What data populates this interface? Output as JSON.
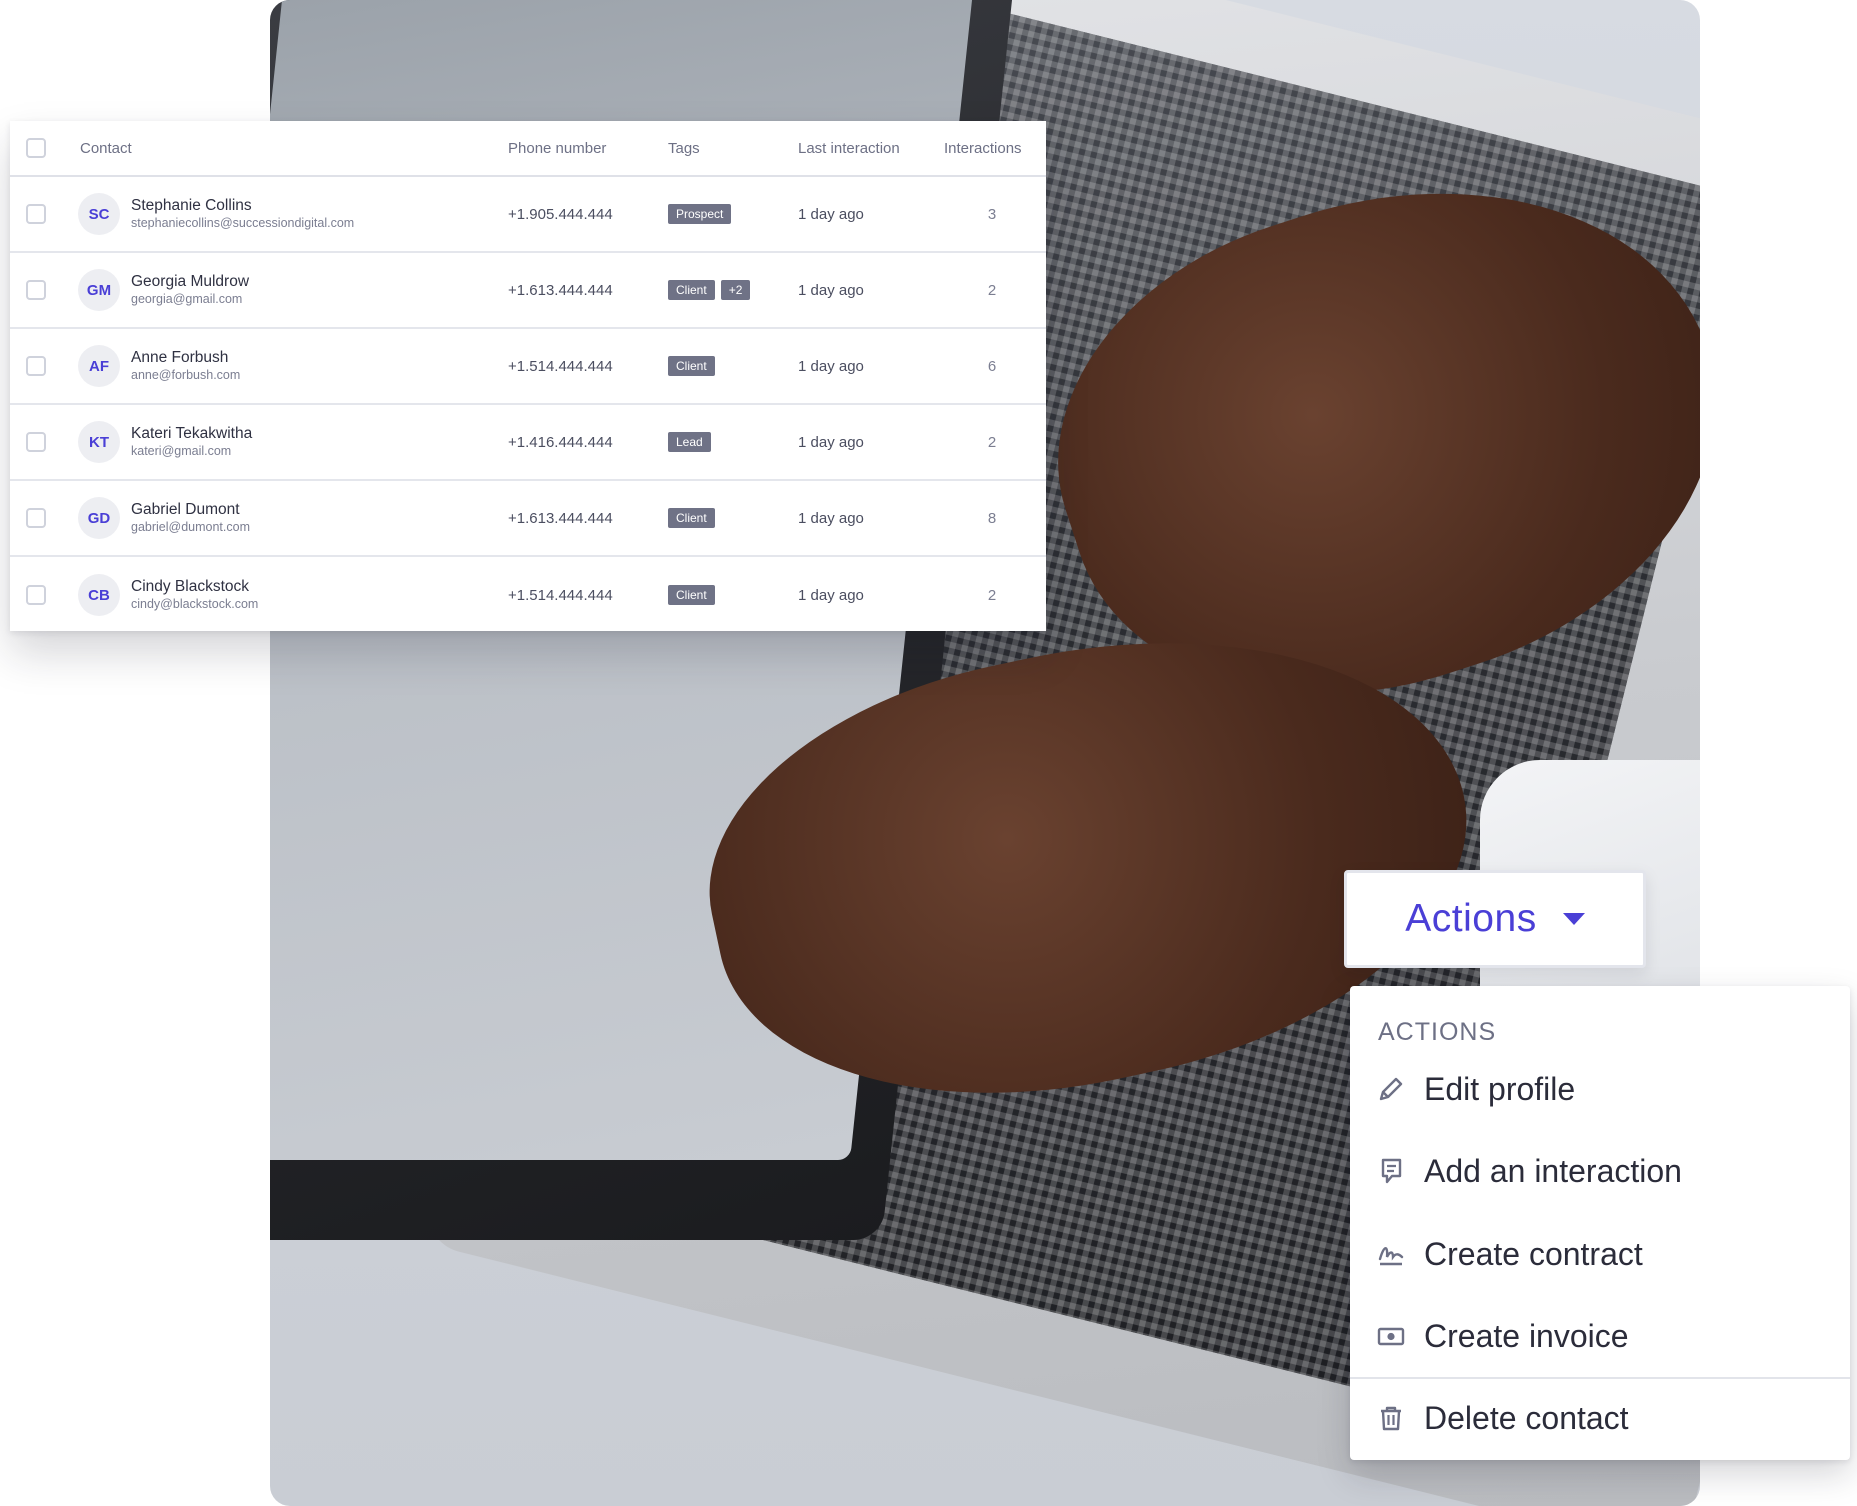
{
  "table": {
    "headers": {
      "contact": "Contact",
      "phone": "Phone number",
      "tags": "Tags",
      "last_interaction": "Last interaction",
      "interactions": "Interactions"
    },
    "rows": [
      {
        "initials": "SC",
        "name": "Stephanie Collins",
        "email": "stephaniecollins@successiondigital.com",
        "phone": "+1.905.444.444",
        "tags": [
          "Prospect"
        ],
        "last": "1 day ago",
        "count": "3"
      },
      {
        "initials": "GM",
        "name": "Georgia Muldrow",
        "email": "georgia@gmail.com",
        "phone": "+1.613.444.444",
        "tags": [
          "Client",
          "+2"
        ],
        "last": "1 day ago",
        "count": "2"
      },
      {
        "initials": "AF",
        "name": "Anne Forbush",
        "email": "anne@forbush.com",
        "phone": "+1.514.444.444",
        "tags": [
          "Client"
        ],
        "last": "1 day ago",
        "count": "6"
      },
      {
        "initials": "KT",
        "name": "Kateri Tekakwitha",
        "email": "kateri@gmail.com",
        "phone": "+1.416.444.444",
        "tags": [
          "Lead"
        ],
        "last": "1 day ago",
        "count": "2"
      },
      {
        "initials": "GD",
        "name": "Gabriel Dumont",
        "email": "gabriel@dumont.com",
        "phone": "+1.613.444.444",
        "tags": [
          "Client"
        ],
        "last": "1 day ago",
        "count": "8"
      },
      {
        "initials": "CB",
        "name": "Cindy Blackstock",
        "email": "cindy@blackstock.com",
        "phone": "+1.514.444.444",
        "tags": [
          "Client"
        ],
        "last": "1 day ago",
        "count": "2"
      }
    ]
  },
  "actions_button": {
    "label": "Actions",
    "icon": "chevron-down-icon"
  },
  "menu": {
    "heading": "ACTIONS",
    "items": [
      {
        "label": "Edit profile",
        "icon": "pencil-icon"
      },
      {
        "label": "Add an interaction",
        "icon": "note-icon"
      },
      {
        "label": "Create contract",
        "icon": "signature-icon"
      },
      {
        "label": "Create invoice",
        "icon": "cash-icon"
      },
      {
        "label": "Delete contact",
        "icon": "trash-icon"
      }
    ]
  },
  "colors": {
    "accent": "#4a3fd6",
    "tag_bg": "#6f7286",
    "text": "#2b2c3a",
    "muted": "#6d7085"
  }
}
